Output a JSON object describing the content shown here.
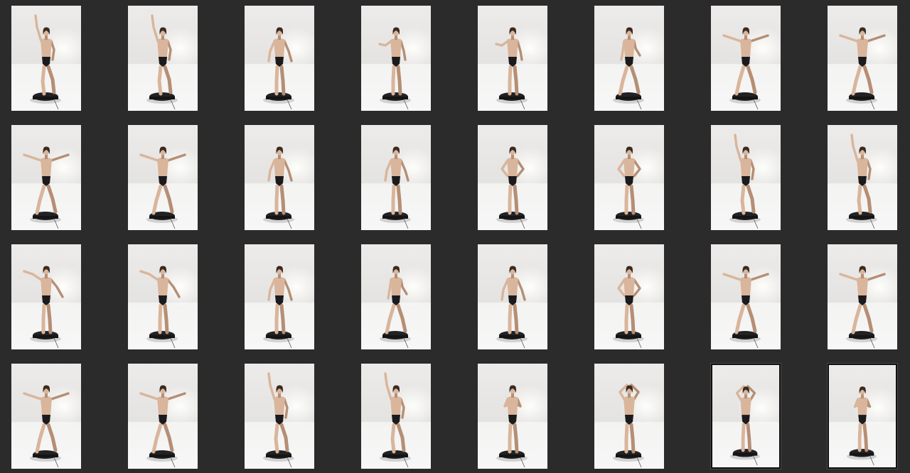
{
  "viewer": {
    "background_color": "#2b2b2b",
    "selection_color": "#111111"
  },
  "thumbnails": [
    {
      "pose": "arm-up"
    },
    {
      "pose": "arm-up"
    },
    {
      "pose": "back-arms-low"
    },
    {
      "pose": "back-turn"
    },
    {
      "pose": "back-turn"
    },
    {
      "pose": "side-walk"
    },
    {
      "pose": "arms-out"
    },
    {
      "pose": "arms-out"
    },
    {
      "pose": "arms-out"
    },
    {
      "pose": "arms-out"
    },
    {
      "pose": "front-arms-low"
    },
    {
      "pose": "front-arms-low"
    },
    {
      "pose": "front-hands-hips"
    },
    {
      "pose": "front-hands-hips"
    },
    {
      "pose": "arm-up"
    },
    {
      "pose": "arm-up"
    },
    {
      "pose": "back-arms-out"
    },
    {
      "pose": "back-arms-out"
    },
    {
      "pose": "back-arms-low"
    },
    {
      "pose": "side-walk"
    },
    {
      "pose": "front-arms-low"
    },
    {
      "pose": "front-hands-hips"
    },
    {
      "pose": "arms-out"
    },
    {
      "pose": "arms-out"
    },
    {
      "pose": "arms-out"
    },
    {
      "pose": "arms-out"
    },
    {
      "pose": "arm-up"
    },
    {
      "pose": "arm-up"
    },
    {
      "pose": "hands-chest"
    },
    {
      "pose": "hands-head"
    },
    {
      "pose": "hands-head",
      "selected": true
    },
    {
      "pose": "hands-chest",
      "selected": true
    }
  ]
}
